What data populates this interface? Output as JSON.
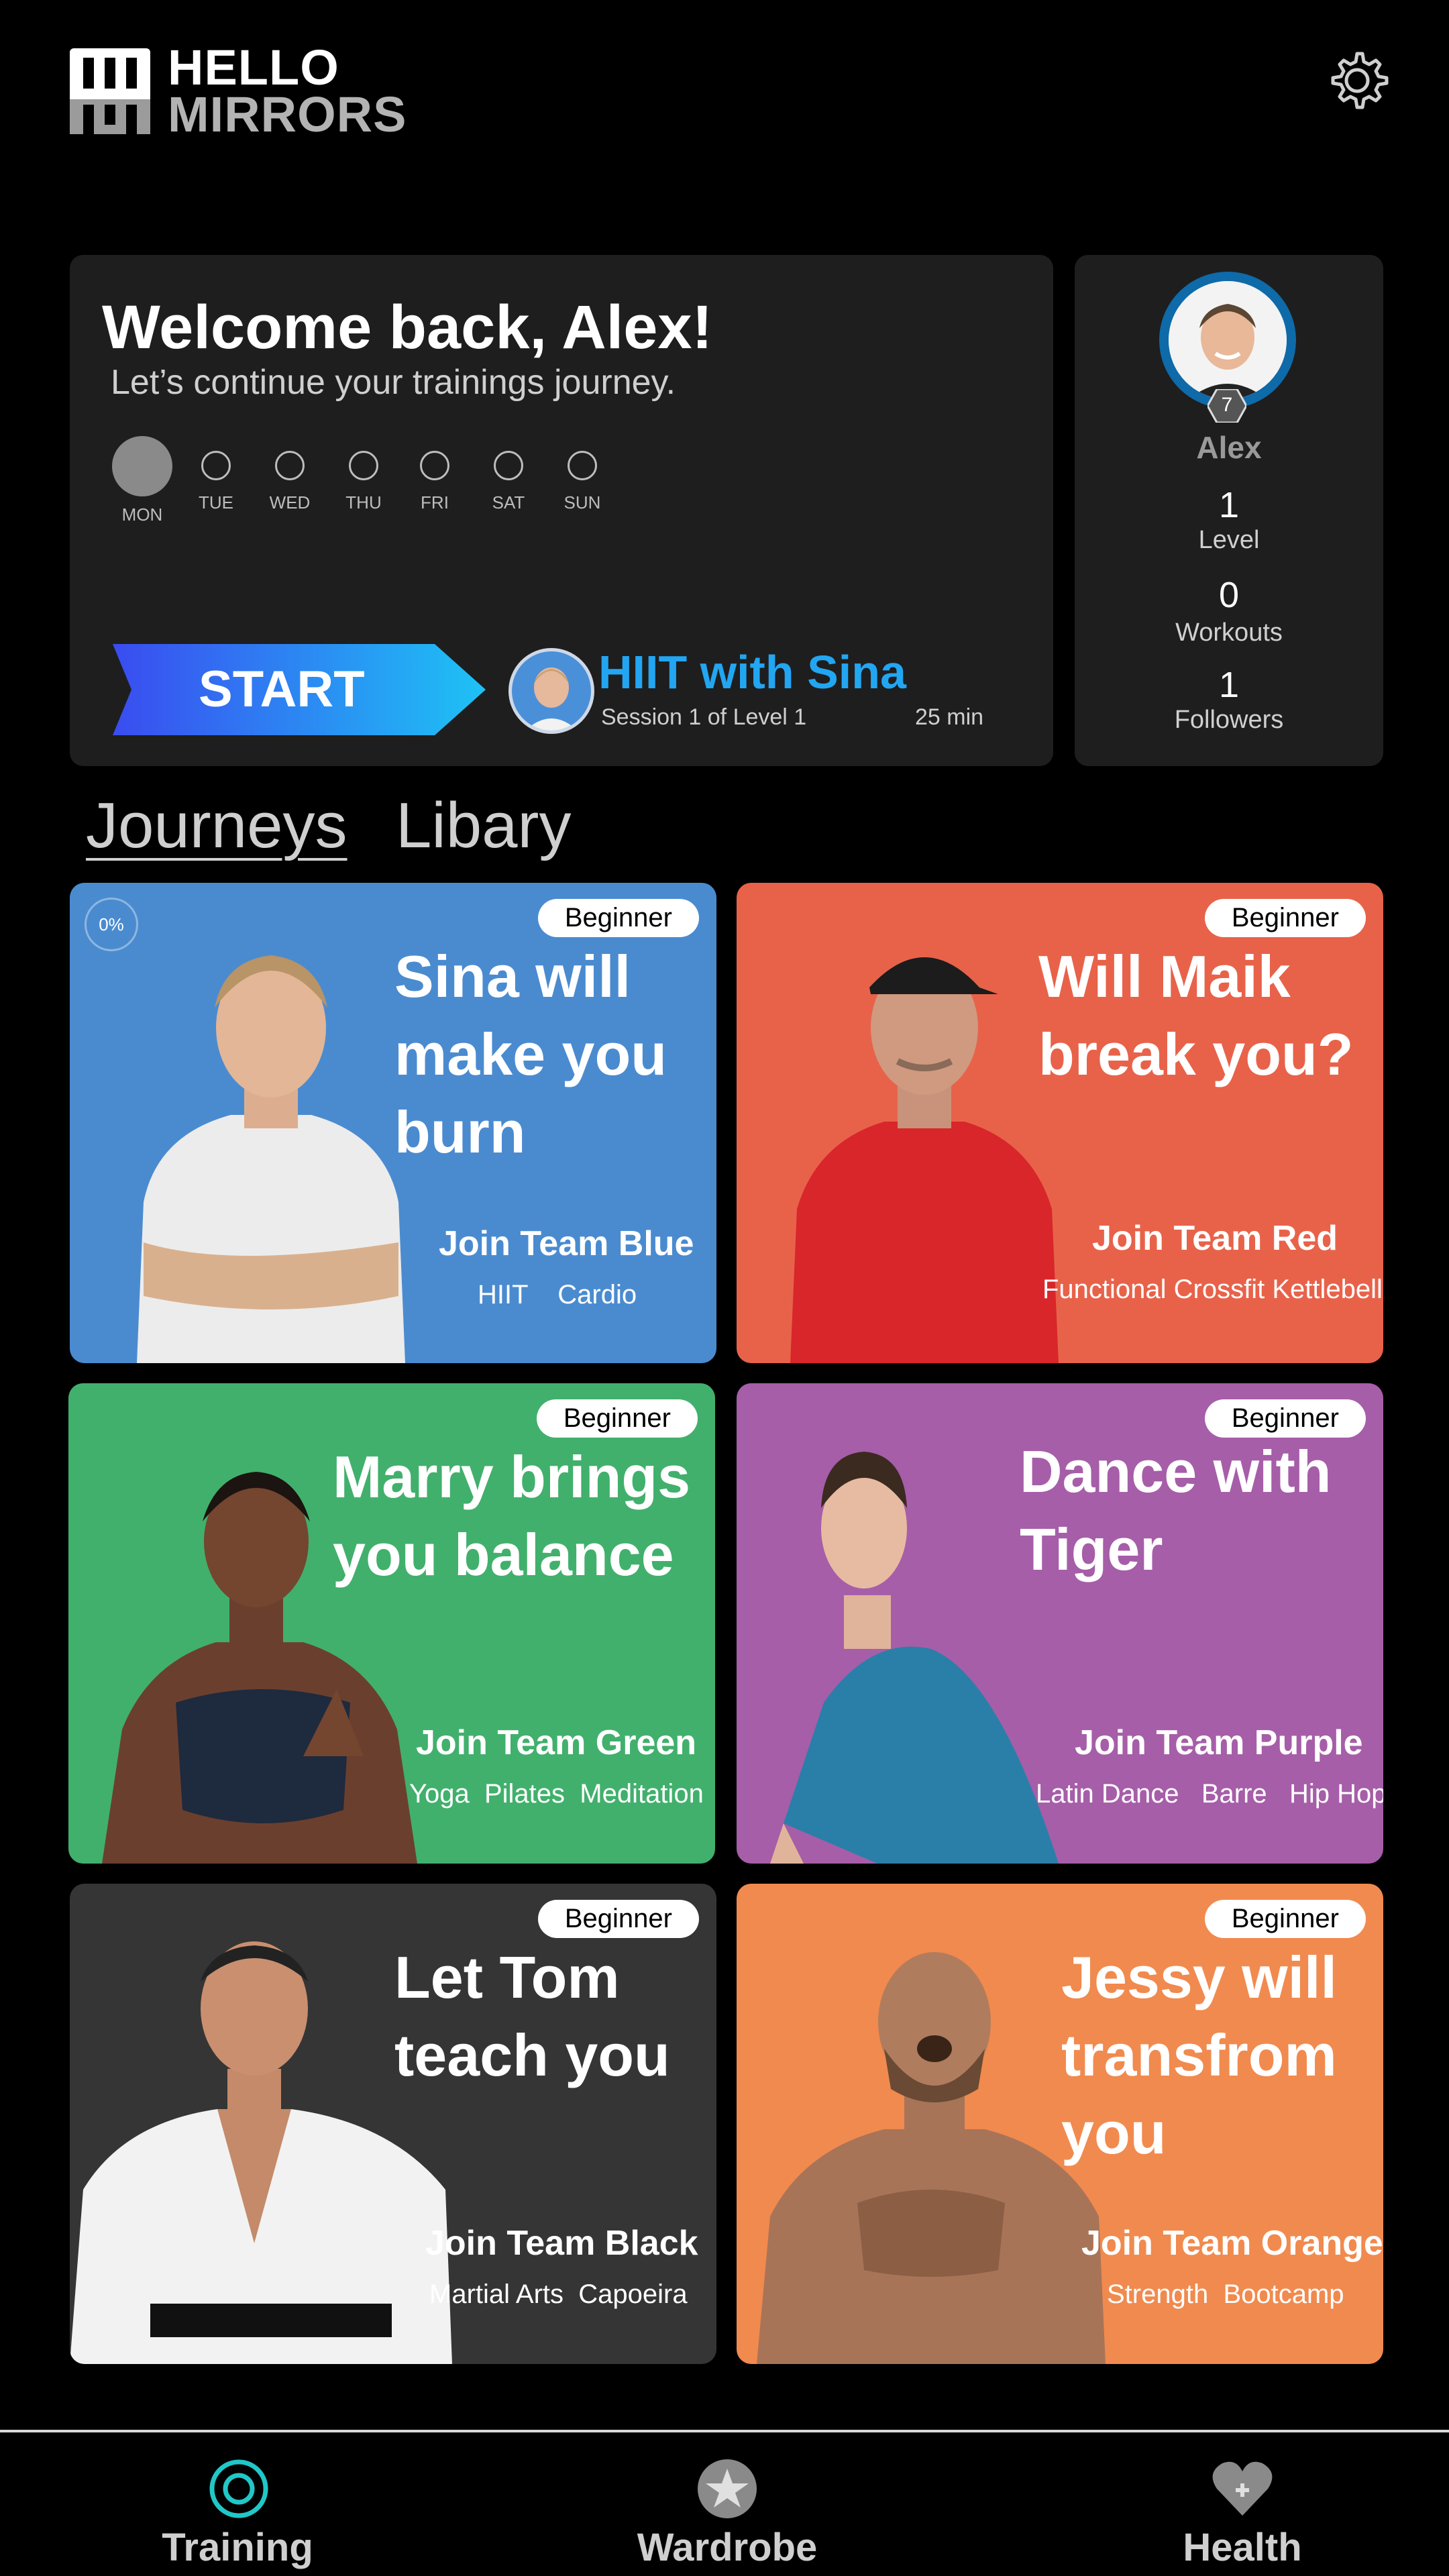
{
  "brand": {
    "line1": "HELLO",
    "line2": "MIRRORS"
  },
  "welcome": {
    "title": "Welcome back, Alex!",
    "subtitle": "Let’s continue your trainings journey.",
    "days": [
      "MON",
      "TUE",
      "WED",
      "THU",
      "FRI",
      "SAT",
      "SUN"
    ],
    "start_label": "START",
    "next_title": "HIIT with Sina",
    "next_session": "Session 1 of Level 1",
    "next_duration": "25 min"
  },
  "profile": {
    "name": "Alex",
    "badge_level": "7",
    "stats": [
      {
        "value": "1",
        "label": "Level"
      },
      {
        "value": "0",
        "label": "Workouts"
      },
      {
        "value": "1",
        "label": "Followers"
      }
    ]
  },
  "tabs": [
    "Journeys",
    "Libary"
  ],
  "cards": [
    {
      "badge": "Beginner",
      "progress": "0%",
      "title_lines": [
        "Sina will",
        "make you",
        "burn"
      ],
      "team": "Join Team Blue",
      "tags": "HIIT    Cardio",
      "color": "#4a8bd0"
    },
    {
      "badge": "Beginner",
      "title_lines": [
        "Will Maik",
        "break you?"
      ],
      "team": "Join Team Red",
      "tags": "Functional Crossfit Kettlebell",
      "color": "#e8624a"
    },
    {
      "badge": "Beginner",
      "title_lines": [
        "Marry brings",
        "you balance"
      ],
      "team": "Join Team Green",
      "tags": "Yoga  Pilates  Meditation",
      "color": "#41b06c"
    },
    {
      "badge": "Beginner",
      "title_lines": [
        "Dance with",
        "Tiger"
      ],
      "team": "Join Team Purple",
      "tags": "Latin Dance   Barre   Hip Hop",
      "color": "#a65ea8"
    },
    {
      "badge": "Beginner",
      "title_lines": [
        "Let Tom",
        "teach you"
      ],
      "team": "Join Team Black",
      "tags": "Martial Arts  Capoeira",
      "color": "#353535"
    },
    {
      "badge": "Beginner",
      "title_lines": [
        "Jessy will",
        "transfrom",
        "you"
      ],
      "team": "Join Team Orange",
      "tags": "Strength  Bootcamp",
      "color": "#f18a4e"
    }
  ],
  "nav": [
    {
      "label": "Training",
      "icon": "target-icon"
    },
    {
      "label": "Wardrobe",
      "icon": "star-icon"
    },
    {
      "label": "Health",
      "icon": "heart-icon"
    }
  ]
}
